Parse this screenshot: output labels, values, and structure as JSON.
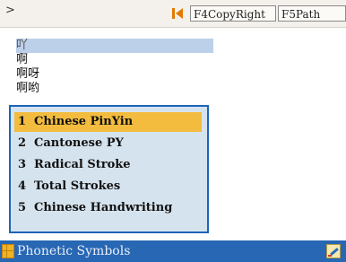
{
  "toolbar": {
    "prompt_symbol": ">",
    "buttons": [
      {
        "key": "f4",
        "label": "F4CopyRight"
      },
      {
        "key": "f5",
        "label": "F5Path"
      }
    ]
  },
  "candidates": [
    {
      "text": "吖",
      "selected": true
    },
    {
      "text": "啊",
      "selected": false
    },
    {
      "text": "啊呀",
      "selected": false
    },
    {
      "text": "啊哟",
      "selected": false
    }
  ],
  "input_menu": {
    "items": [
      {
        "number": "1",
        "label": "Chinese PinYin",
        "highlighted": true
      },
      {
        "number": "2",
        "label": "Cantonese PY",
        "highlighted": false
      },
      {
        "number": "3",
        "label": "Radical Stroke",
        "highlighted": false
      },
      {
        "number": "4",
        "label": "Total Strokes",
        "highlighted": false
      },
      {
        "number": "5",
        "label": "Chinese Handwriting",
        "highlighted": false
      }
    ]
  },
  "statusbar": {
    "label": "Phonetic Symbols",
    "icons": [
      "grid-icon",
      "edit-icon"
    ]
  },
  "colors": {
    "menu_border": "#1d65b7",
    "menu_background": "#d5e3ee",
    "menu_highlight": "#f3bc3e",
    "candidate_selected": "#bcd0ea",
    "statusbar": "#2767b4",
    "nav_icon": "#e07a00"
  }
}
